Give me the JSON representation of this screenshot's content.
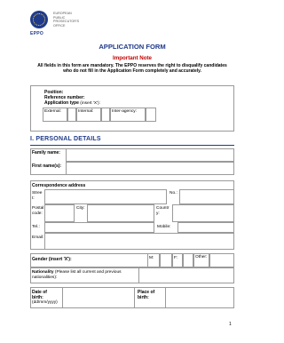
{
  "logo": {
    "acronym": "EPPO",
    "org_lines": [
      "EUROPEAN",
      "PUBLIC",
      "PROSECUTOR'S",
      "OFFICE"
    ]
  },
  "title": "APPLICATION FORM",
  "important_note": {
    "heading": "Important Note",
    "text": "All fields in this form are mandatory. The EPPO reserves the right to disqualify candidates who do not fill in the Application Form completely and accurately."
  },
  "position_box": {
    "position": "Position:",
    "reference": "Reference number:",
    "application_type": "Application type",
    "application_type_hint": "(insert 'X'):",
    "options": [
      "External:",
      "Internal:",
      "Inter-agency:"
    ]
  },
  "section": "I. PERSONAL DETAILS",
  "fields": {
    "family_name": "Family name:",
    "first_names": "First name(s):",
    "correspondence": "Correspondence address",
    "street": "Street:",
    "no": "No.:",
    "postal_code": "Postal code:",
    "city": "City:",
    "country": "Country:",
    "tel": "Tel.:",
    "mobile": "Mobile:",
    "email": "Email:",
    "gender": "Gender (insert 'X'):",
    "gender_m": "M:",
    "gender_f": "F:",
    "gender_other": "Other:",
    "nationality": "Nationality",
    "nationality_hint": "(Please list all current and previous nationalities):",
    "dob": "Date of birth:",
    "dob_hint": "(dd/mm/yyyy)",
    "pob": "Place of birth:"
  },
  "page_number": "1",
  "colors": {
    "accent": "#1f3a8a",
    "note": "#c00000",
    "border": "#9a9a9a"
  }
}
